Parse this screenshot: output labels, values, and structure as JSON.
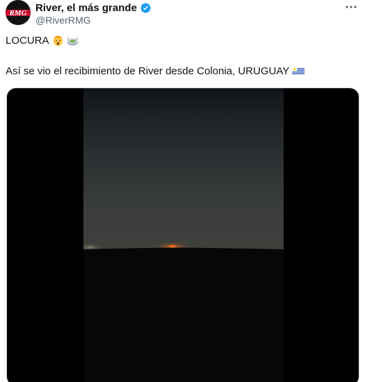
{
  "tweet": {
    "author": {
      "display_name": "River, el más grande",
      "handle": "@RiverRMG",
      "avatar_text": "RMG",
      "verified": true
    },
    "text_line_1": "LOCURA",
    "text_line_1_emojis": [
      "shocked-face-emoji",
      "stadium-emoji"
    ],
    "text_line_2": "Así se vio el recibimiento de River desde Colonia, URUGUAY",
    "text_line_2_emojis": [
      "uruguay-flag-emoji"
    ]
  },
  "colors": {
    "verified_blue": "#1d9bf0",
    "text_primary": "#0f1419",
    "text_secondary": "#536471",
    "media_background": "#000000"
  }
}
